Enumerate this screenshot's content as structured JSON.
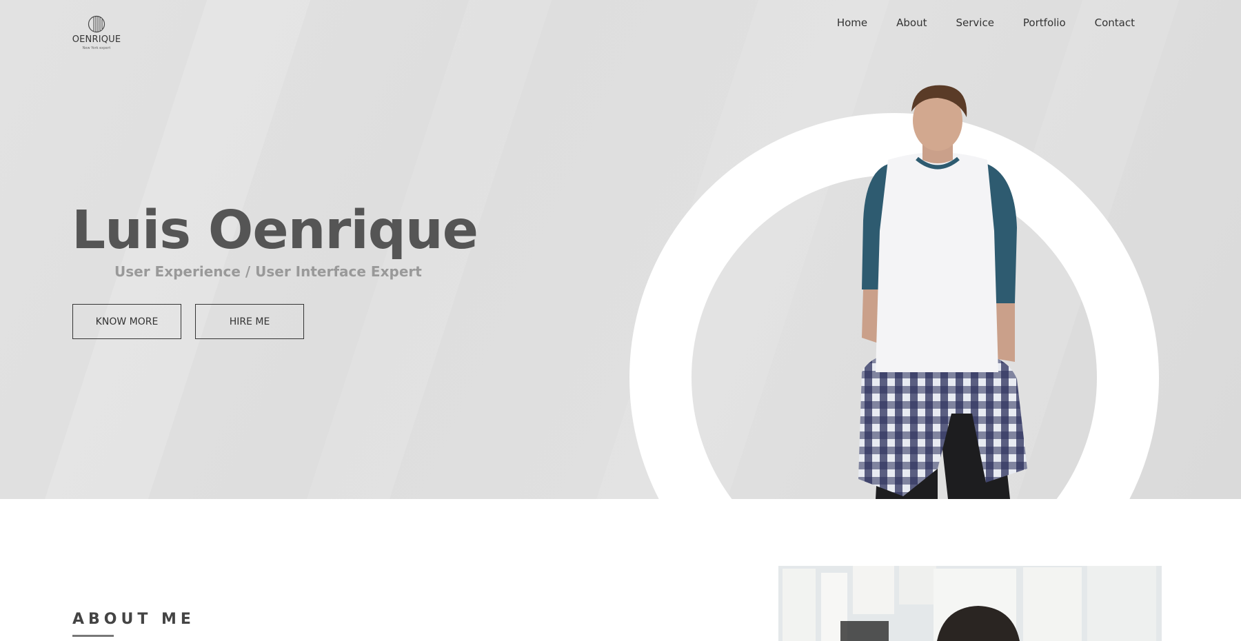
{
  "brand": {
    "name": "OENRIQUE",
    "tagline": "New York expert"
  },
  "nav": {
    "items": [
      "Home",
      "About",
      "Service",
      "Portfolio",
      "Contact"
    ]
  },
  "hero": {
    "name": "Luis Oenrique",
    "subtitle": "User Experience / User Interface Expert",
    "buttons": {
      "know_more": "KNOW MORE",
      "hire_me": "HIRE ME"
    }
  },
  "about": {
    "title": "ABOUT ME"
  },
  "colors": {
    "hero_bg": "#e0e0e0",
    "heading": "#555555",
    "subtitle": "#999999",
    "ring": "#ffffff"
  },
  "icons": {
    "logo": "striped-globe-icon"
  }
}
